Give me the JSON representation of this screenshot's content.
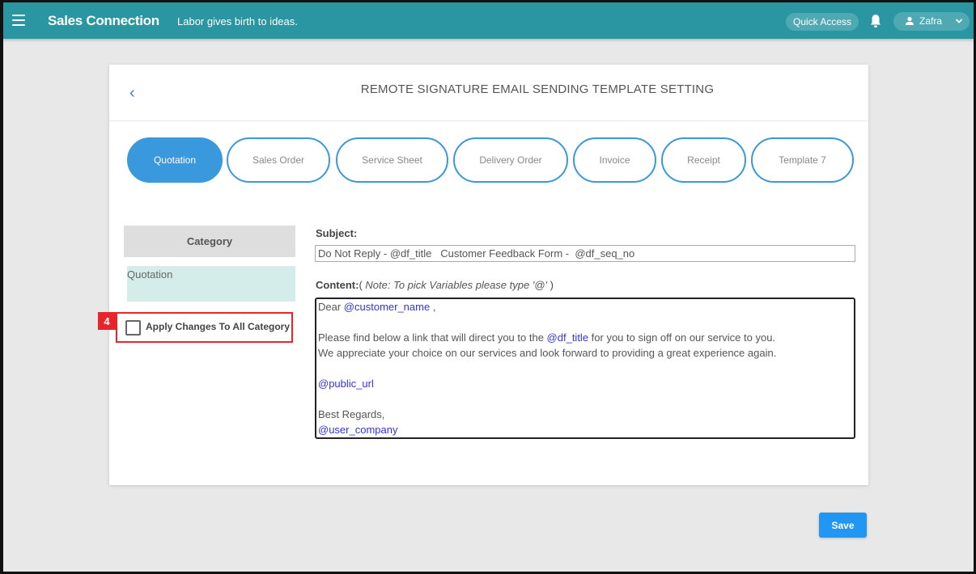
{
  "topbar": {
    "brand": "Sales Connection",
    "motto": "Labor gives birth to ideas.",
    "quick_access_label": "Quick Access",
    "user_name": "Zafra",
    "menu_icon": "hamburger-menu-icon",
    "bell_icon": "bell-icon",
    "user_icon": "user-icon",
    "chevron_icon": "chevron-down-icon",
    "color": "#2996a1"
  },
  "page": {
    "title": "REMOTE SIGNATURE EMAIL SENDING TEMPLATE SETTING",
    "back_label": "‹"
  },
  "tabs": [
    {
      "label": "Quotation",
      "active": true
    },
    {
      "label": "Sales Order",
      "active": false
    },
    {
      "label": "Service Sheet",
      "active": false
    },
    {
      "label": "Delivery Order",
      "active": false
    },
    {
      "label": "Invoice",
      "active": false
    },
    {
      "label": "Receipt",
      "active": false
    },
    {
      "label": "Template 7",
      "active": false
    }
  ],
  "category": {
    "header": "Category",
    "items": [
      "Quotation"
    ],
    "apply_all_label": "Apply Changes To All Category",
    "apply_all_checked": false,
    "annotation_badge": "4"
  },
  "form": {
    "subject_label": "Subject:",
    "subject_value": "Do Not Reply - @df_title   Customer Feedback Form -  @df_seq_no",
    "content_label": "Content:",
    "content_note_open": "( ",
    "content_note": "Note: To pick Variables please type '@'",
    "content_note_close": " )",
    "content": {
      "greeting": "Dear ",
      "greeting_var": "@customer_name",
      "greeting_end": " ,",
      "line1_start": "Please find below a link that will direct you to the ",
      "line1_var": "@df_title",
      "line1_end": " for you to sign off on our service to you.",
      "line2": "We appreciate your choice on our services and look forward to providing a great experience again.",
      "url_var": "@public_url",
      "closing": "Best Regards,",
      "company_var": "@user_company"
    }
  },
  "actions": {
    "save_label": "Save",
    "accent": "#2196f3"
  }
}
